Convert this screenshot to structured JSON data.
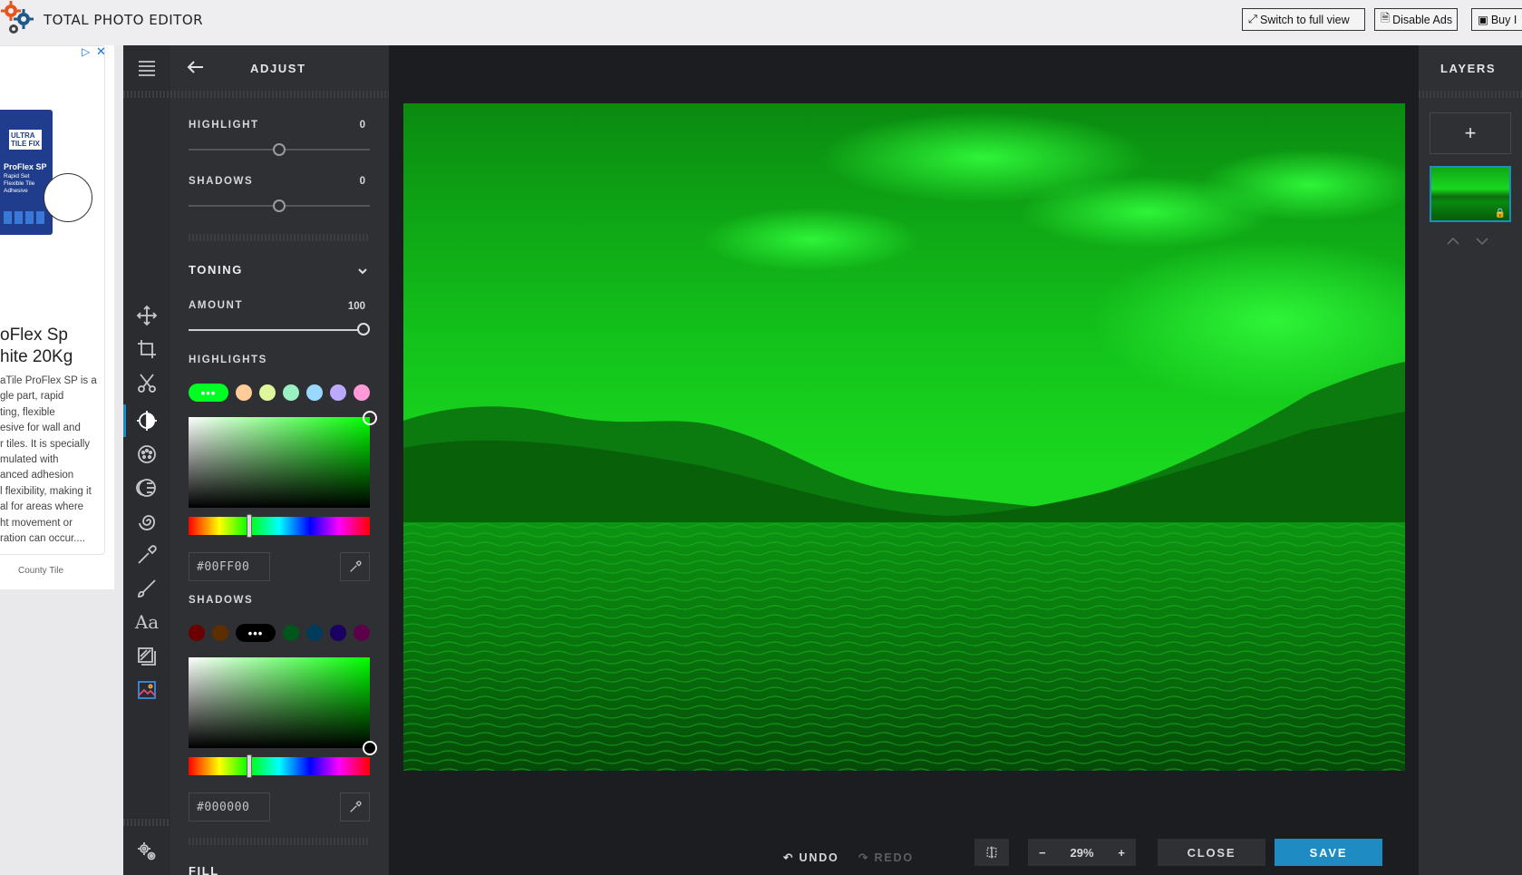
{
  "app": {
    "title": "TOTAL PHOTO EDITOR"
  },
  "topbar": {
    "full_view_label": "Switch to full view",
    "disable_ads_label": "Disable Ads",
    "buy_label": "Buy I"
  },
  "ad": {
    "headline_line1": "oFlex Sp",
    "headline_line2": "hite 20Kg",
    "body_lines": [
      "aTile ProFlex SP is a",
      "gle part, rapid",
      "ting, flexible",
      "esive for wall and",
      "r tiles. It is specially",
      "mulated with",
      "anced adhesion",
      "l flexibility, making it",
      "al for areas where",
      "ht movement or",
      "ration can occur...."
    ],
    "source": "County Tile",
    "product_brand": "ULTRA TILE FIX",
    "product_name": "ProFlex SP",
    "product_sub": "Rapid Set Flexible Tile Adhesive"
  },
  "panel": {
    "title": "ADJUST",
    "highlight_label": "HIGHLIGHT",
    "highlight_value": "0",
    "highlight_level": 0.5,
    "shadows_label": "SHADOWS",
    "shadows_value": "0",
    "shadows_level": 0.5,
    "toning_label": "TONING",
    "amount_label": "AMOUNT",
    "amount_value": "100",
    "amount_level": 1.0,
    "highlights_section_label": "HIGHLIGHTS",
    "highlights_swatches": [
      "#ffcc99",
      "#ddf79a",
      "#99f0c0",
      "#99d8ff",
      "#bba8ff",
      "#ff99d8"
    ],
    "highlights_selected_color": "#00ff00",
    "highlights_hex": "#00FF00",
    "shadows_section_label": "SHADOWS",
    "shadows_swatches_left": [
      "#6b0000",
      "#5c2e00"
    ],
    "shadows_swatches_right": [
      "#00561b",
      "#003b5c",
      "#1a0060",
      "#5c0049"
    ],
    "shadows_selected_color": "#000000",
    "shadows_hex": "#000000",
    "next_section_label": "FILL"
  },
  "toolbar": {
    "undo_label": "UNDO",
    "redo_label": "REDO",
    "zoom_value": "29%",
    "zoom_minus": "−",
    "zoom_plus": "+",
    "close_label": "CLOSE",
    "save_label": "SAVE"
  },
  "layers": {
    "title": "LAYERS",
    "add_symbol": "+"
  },
  "colors": {
    "accent": "#1e8bc3",
    "tint": "#00ff00"
  }
}
